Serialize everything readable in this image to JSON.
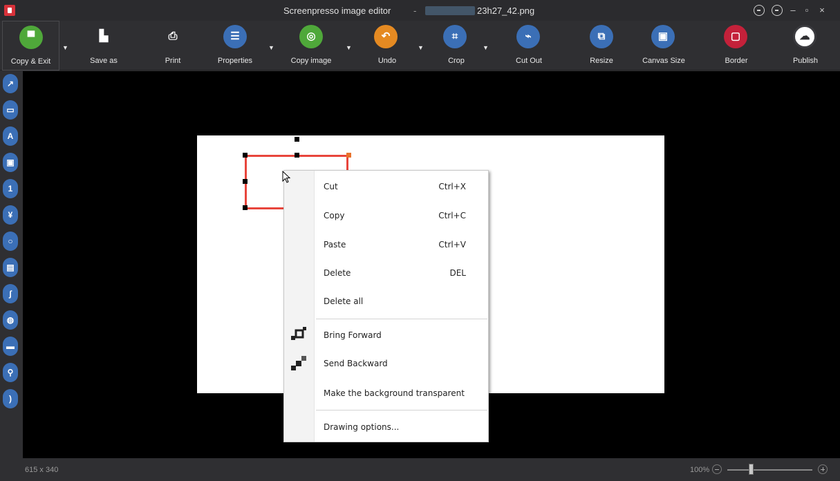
{
  "window": {
    "title": "Screenpresso image editor",
    "title_sep": "-",
    "file_name": "23h27_42.png"
  },
  "toolbar": {
    "copy_exit": "Copy & Exit",
    "save_as": "Save as",
    "print": "Print",
    "properties": "Properties",
    "copy_image": "Copy image",
    "undo": "Undo",
    "crop": "Crop",
    "cut_out": "Cut Out",
    "resize": "Resize",
    "canvas_size": "Canvas Size",
    "border": "Border",
    "publish": "Publish"
  },
  "colors": {
    "green": "#4fa83a",
    "blue": "#3b6fb6",
    "orange": "#e58a22",
    "red": "#c4213a",
    "selection_red": "#e8453c"
  },
  "left_tools": [
    {
      "icon": "arrow-icon",
      "glyph": "↗"
    },
    {
      "icon": "rectangle-icon",
      "glyph": "▭"
    },
    {
      "icon": "text-icon",
      "glyph": "A"
    },
    {
      "icon": "callout-icon",
      "glyph": "▣"
    },
    {
      "icon": "step-number-icon",
      "glyph": "1"
    },
    {
      "icon": "highlight-icon",
      "glyph": "¥"
    },
    {
      "icon": "ellipse-icon",
      "glyph": "○"
    },
    {
      "icon": "stamp-icon",
      "glyph": "▤"
    },
    {
      "icon": "freehand-icon",
      "glyph": "∫"
    },
    {
      "icon": "blur-icon",
      "glyph": "◍"
    },
    {
      "icon": "watermark-icon",
      "glyph": "▬"
    },
    {
      "icon": "magnifier-icon",
      "glyph": "⚲"
    },
    {
      "icon": "more-icon",
      "glyph": ")"
    }
  ],
  "context_menu": {
    "cut": "Cut",
    "cut_key": "Ctrl+X",
    "copy": "Copy",
    "copy_key": "Ctrl+C",
    "paste": "Paste",
    "paste_key": "Ctrl+V",
    "delete": "Delete",
    "delete_key": "DEL",
    "delete_all": "Delete all",
    "bring_forward": "Bring Forward",
    "send_backward": "Send Backward",
    "make_transparent": "Make the background transparent",
    "drawing_options": "Drawing options..."
  },
  "status": {
    "dimensions": "615 x 340",
    "zoom": "100%"
  }
}
